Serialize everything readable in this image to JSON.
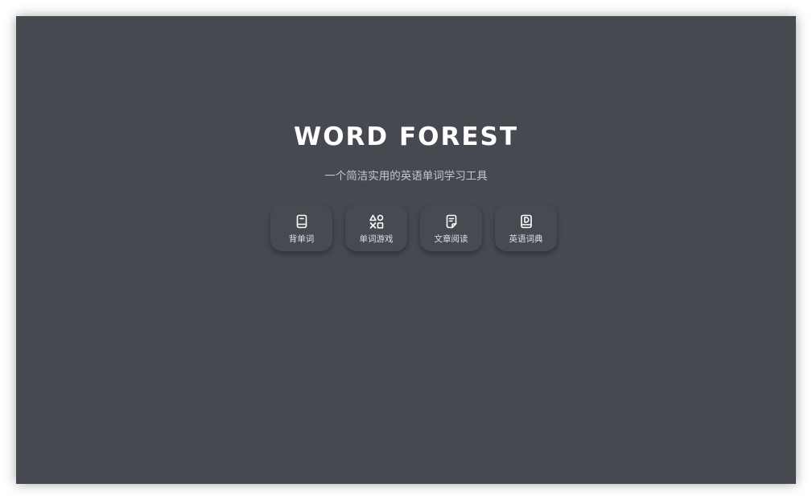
{
  "app": {
    "title": "WORD FOREST",
    "subtitle": "一个简洁实用的英语单词学习工具"
  },
  "nav": {
    "items": [
      {
        "label": "背单词",
        "icon": "book-icon"
      },
      {
        "label": "单词游戏",
        "icon": "game-shapes-icon"
      },
      {
        "label": "文章阅读",
        "icon": "article-icon"
      },
      {
        "label": "英语词典",
        "icon": "dictionary-icon"
      }
    ]
  },
  "colors": {
    "background": "#474950",
    "button": "#484a51",
    "title": "#ffffff",
    "subtitle": "#c4c6cc"
  }
}
